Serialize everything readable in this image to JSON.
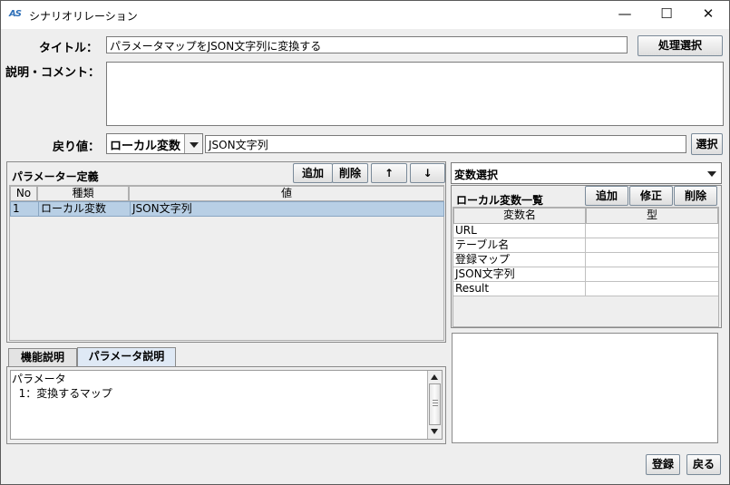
{
  "window": {
    "app_icon": "AS",
    "title": "シナリオリレーション",
    "min": "—",
    "max": "☐",
    "close": "✕"
  },
  "form": {
    "title_label": "タイトル：",
    "title_value": "パラメータマップをJSON文字列に変換する",
    "process_select_button": "処理選択",
    "comment_label": "説明・コメント：",
    "comment_value": "",
    "return_label": "戻り値：",
    "return_type": "ローカル変数",
    "return_value": "JSON文字列",
    "select_button": "選択"
  },
  "param_panel": {
    "title": "パラメーター定義",
    "add_button": "追加",
    "delete_button": "削除",
    "up_button": "↑",
    "down_button": "↓",
    "columns": [
      "No",
      "種類",
      "値"
    ],
    "rows": [
      {
        "no": "1",
        "kind": "ローカル変数",
        "value": "JSON文字列"
      }
    ]
  },
  "help_panel": {
    "tabs": [
      "機能説明",
      "パラメータ説明"
    ],
    "active_tab": "パラメータ説明",
    "lines": [
      "パラメータ",
      "  1：変換するマップ"
    ]
  },
  "var_panel": {
    "selector": "変数選択",
    "list_title": "ローカル変数一覧",
    "add_button": "追加",
    "edit_button": "修正",
    "delete_button": "削除",
    "columns": [
      "変数名",
      "型"
    ],
    "rows": [
      {
        "name": "URL",
        "type": ""
      },
      {
        "name": "テーブル名",
        "type": ""
      },
      {
        "name": "登録マップ",
        "type": ""
      },
      {
        "name": "JSON文字列",
        "type": ""
      },
      {
        "name": "Result",
        "type": ""
      }
    ]
  },
  "footer": {
    "register_button": "登録",
    "back_button": "戻る"
  },
  "colors": {
    "selection": "#b8cfe5",
    "window_bg": "#eeeeee",
    "tab_active": "#dfe9f5"
  }
}
